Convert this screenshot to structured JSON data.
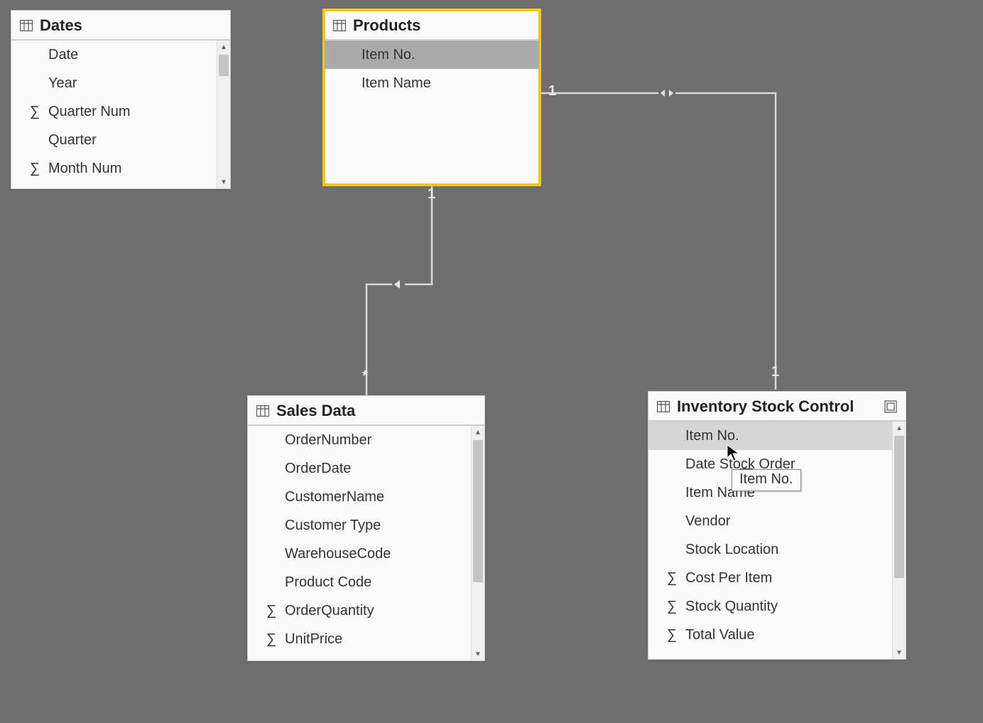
{
  "tables": {
    "dates": {
      "title": "Dates",
      "fields": [
        {
          "label": "Date",
          "sigma": false
        },
        {
          "label": "Year",
          "sigma": false
        },
        {
          "label": "Quarter Num",
          "sigma": true
        },
        {
          "label": "Quarter",
          "sigma": false
        },
        {
          "label": "Month Num",
          "sigma": true
        }
      ]
    },
    "products": {
      "title": "Products",
      "fields": [
        {
          "label": "Item No.",
          "sigma": false,
          "highlight": true
        },
        {
          "label": "Item Name",
          "sigma": false
        }
      ]
    },
    "sales": {
      "title": "Sales Data",
      "fields": [
        {
          "label": "OrderNumber",
          "sigma": false
        },
        {
          "label": "OrderDate",
          "sigma": false
        },
        {
          "label": "CustomerName",
          "sigma": false
        },
        {
          "label": "Customer Type",
          "sigma": false
        },
        {
          "label": "WarehouseCode",
          "sigma": false
        },
        {
          "label": "Product Code",
          "sigma": false
        },
        {
          "label": "OrderQuantity",
          "sigma": true
        },
        {
          "label": "UnitPrice",
          "sigma": true
        }
      ]
    },
    "inventory": {
      "title": "Inventory Stock Control",
      "fields": [
        {
          "label": "Item No.",
          "sigma": false,
          "light": true
        },
        {
          "label": "Date Stock Order",
          "sigma": false
        },
        {
          "label": "Item Name",
          "sigma": false
        },
        {
          "label": "Vendor",
          "sigma": false
        },
        {
          "label": "Stock Location",
          "sigma": false
        },
        {
          "label": "Cost Per Item",
          "sigma": true
        },
        {
          "label": "Stock Quantity",
          "sigma": true
        },
        {
          "label": "Total Value",
          "sigma": true
        }
      ]
    }
  },
  "relationships": {
    "products_inventory": {
      "left": "1",
      "right": "1"
    },
    "products_sales": {
      "top": "1",
      "bottom": "*"
    }
  },
  "tooltip": {
    "text": "Item No."
  },
  "sigma_glyph": "∑"
}
